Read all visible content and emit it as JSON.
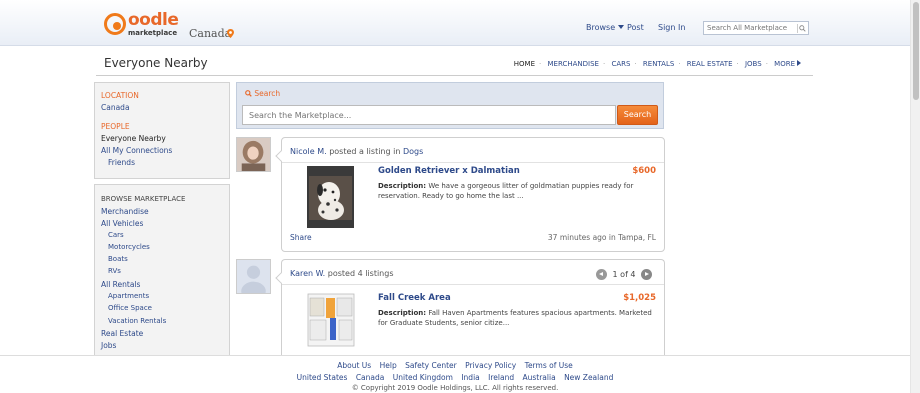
{
  "header": {
    "logo_word": "oodle",
    "logo_sub": "marketplace",
    "region": "Canada",
    "browse": "Browse",
    "post": "Post",
    "sign_in": "Sign In",
    "search_placeholder": "Search All Marketplace"
  },
  "subnav": {
    "title": "Everyone Nearby",
    "links": [
      "HOME",
      "MERCHANDISE",
      "CARS",
      "RENTALS",
      "REAL ESTATE",
      "JOBS",
      "MORE"
    ]
  },
  "sidebar": {
    "location_head": "LOCATION",
    "location_value": "Canada",
    "people_head": "PEOPLE",
    "people": [
      "Everyone Nearby",
      "All My Connections",
      "Friends"
    ],
    "browse_head": "BROWSE MARKETPLACE",
    "browse": [
      "Merchandise",
      "All Vehicles",
      "Cars",
      "Motorcycles",
      "Boats",
      "RVs",
      "All Rentals",
      "Apartments",
      "Office Space",
      "Vacation Rentals",
      "Real Estate",
      "Jobs"
    ]
  },
  "search": {
    "label": "Search",
    "placeholder": "Search the Marketplace...",
    "button": "Search"
  },
  "feed": [
    {
      "user": "Nicole M.",
      "action": "posted a listing in",
      "category": "Dogs",
      "title": "Golden Retriever x Dalmatian",
      "price": "$600",
      "desc_label": "Description:",
      "desc": "We have a gorgeous litter of goldmatian puppies ready for reservation. Ready to go home the last ...",
      "share": "Share",
      "time": "37 minutes ago in Tampa, FL"
    },
    {
      "user": "Karen W.",
      "action": "posted 4 listings",
      "pager": "1 of 4",
      "title": "Fall Creek Area",
      "price": "$1,025",
      "desc_label": "Description:",
      "desc": "Fall Haven Apartments features spacious apartments. Marketed for Graduate Students, senior citize..."
    }
  ],
  "footer": {
    "links": [
      "About Us",
      "Help",
      "Safety Center",
      "Privacy Policy",
      "Terms of Use"
    ],
    "countries": [
      "United States",
      "Canada",
      "United Kingdom",
      "India",
      "Ireland",
      "Australia",
      "New Zealand"
    ],
    "copyright": "© Copyright 2019 Oodle Holdings, LLC. All rights reserved."
  },
  "colors": {
    "accent": "#e8682a",
    "link": "#2e4a8a"
  }
}
